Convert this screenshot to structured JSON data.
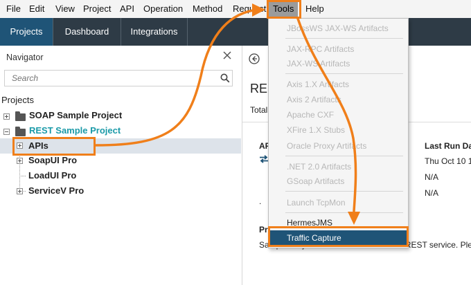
{
  "menubar": {
    "items": [
      "File",
      "Edit",
      "View",
      "Project",
      "API",
      "Operation",
      "Method",
      "Request",
      "Tools",
      "Help"
    ]
  },
  "tabs": [
    "Projects",
    "Dashboard",
    "Integrations"
  ],
  "navigator": {
    "title": "Navigator",
    "search_placeholder": "Search",
    "tree_heading": "Projects",
    "items": [
      "SOAP Sample Project",
      "REST Sample Project",
      "APIs",
      "SoapUI Pro",
      "LoadUI Pro",
      "ServiceV Pro"
    ]
  },
  "main": {
    "title_partial": "RES",
    "total_partial": "Total",
    "col_api_partial": "AP",
    "col_last_run_partial": "Last Run Da",
    "last_run_values": [
      "Thu Oct 10 1",
      "N/A",
      "N/A"
    ],
    "dot": ".",
    "section_partial": "Pr",
    "description_partial": "Sample Projects based on a virtualized REST service. Please"
  },
  "tools_menu": {
    "items": [
      {
        "label": "JBossWS JAX-WS Artifacts",
        "enabled": false
      },
      {
        "label": "JAX-RPC Artifacts",
        "enabled": false
      },
      {
        "label": "JAX-WS Artifacts",
        "enabled": false
      },
      {
        "label": "Axis 1.X Artifacts",
        "enabled": false
      },
      {
        "label": "Axis 2 Artifacts",
        "enabled": false
      },
      {
        "label": "Apache CXF",
        "enabled": false
      },
      {
        "label": "XFire 1.X Stubs",
        "enabled": false
      },
      {
        "label": "Oracle Proxy Artifacts",
        "enabled": false
      },
      {
        "label": ".NET 2.0 Artifacts",
        "enabled": false
      },
      {
        "label": "GSoap Artifacts",
        "enabled": false
      },
      {
        "label": "Launch TcpMon",
        "enabled": false
      },
      {
        "label": "HermesJMS",
        "enabled": true
      },
      {
        "label": "Traffic Capture",
        "enabled": true,
        "selected": true
      }
    ]
  },
  "colors": {
    "tabbar": "#2e3b46",
    "active_tab": "#1f5477",
    "highlight": "#f07f1a",
    "rest_project": "#1a9aa8"
  },
  "icons": [
    "close-icon",
    "search-icon",
    "back-icon",
    "folder-icon",
    "expand-icon",
    "transfer-icon"
  ]
}
